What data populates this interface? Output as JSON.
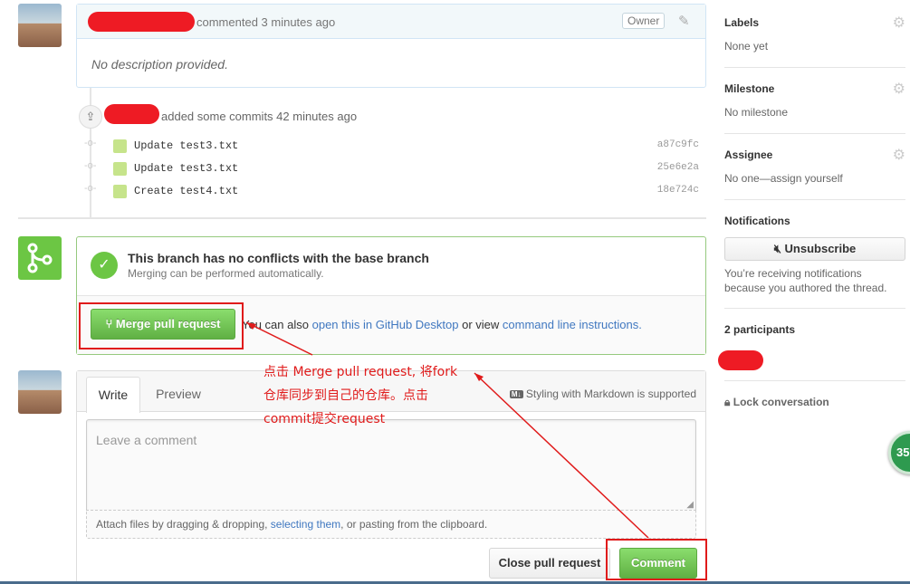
{
  "comment": {
    "meta_text": "commented 3 minutes ago",
    "owner_badge": "Owner",
    "body": "No description provided."
  },
  "commits": {
    "summary": "added some commits 42 minutes ago",
    "items": [
      {
        "message": "Update test3.txt",
        "sha": "a87c9fc"
      },
      {
        "message": "Update test3.txt",
        "sha": "25e6e2a"
      },
      {
        "message": "Create test4.txt",
        "sha": "18e724c"
      }
    ]
  },
  "merge": {
    "title": "This branch has no conflicts with the base branch",
    "subtitle": "Merging can be performed automatically.",
    "button_label": "Merge pull request",
    "also_text": "You can also",
    "desktop_link": "open this in GitHub Desktop",
    "or_view": "or view",
    "cli_link": "command line instructions."
  },
  "editor": {
    "tab_write": "Write",
    "tab_preview": "Preview",
    "markdown_badge": "M↓",
    "markdown_note": "Styling with Markdown is supported",
    "placeholder": "Leave a comment",
    "attach_prefix": "Attach files by dragging & dropping,",
    "attach_link": "selecting them",
    "attach_suffix": ", or pasting from the clipboard.",
    "close_button": "Close pull request",
    "comment_button": "Comment"
  },
  "annotation": {
    "line1": "点击 Merge pull request, 将fork",
    "line2": "仓库同步到自己的仓库。点击",
    "line3": "commit提交request"
  },
  "sidebar": {
    "labels_title": "Labels",
    "labels_value": "None yet",
    "milestone_title": "Milestone",
    "milestone_value": "No milestone",
    "assignee_title": "Assignee",
    "assignee_value": "No one—assign yourself",
    "notifications_title": "Notifications",
    "unsubscribe_label": "Unsubscribe",
    "notifications_reason_1": "You’re receiving notifications",
    "notifications_reason_2": "because you authored the thread.",
    "participants_title": "2 participants",
    "lock_label": "Lock conversation",
    "badge_number": "35"
  },
  "colors": {
    "accent_green": "#6cc644",
    "link_blue": "#4078c0",
    "annotation_red": "#e01b1b"
  }
}
